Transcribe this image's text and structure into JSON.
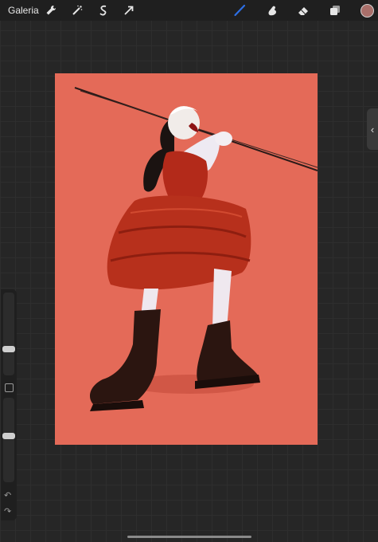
{
  "topbar": {
    "gallery_label": "Galeria",
    "left_tools": [
      {
        "name": "actions-wrench-icon"
      },
      {
        "name": "adjustments-wand-icon"
      },
      {
        "name": "selection-icon"
      },
      {
        "name": "transform-arrow-icon"
      }
    ],
    "right_tools": [
      {
        "name": "brush-icon",
        "active": true
      },
      {
        "name": "smudge-icon",
        "active": false
      },
      {
        "name": "eraser-icon",
        "active": false
      },
      {
        "name": "layers-icon",
        "active": false
      }
    ],
    "current_color": "#a96f6a",
    "active_tool_color": "#2d6fe6"
  },
  "canvas": {
    "background_color": "#e46a58"
  },
  "sidebar": {
    "brush_size_level": 0.3,
    "opacity_level": 0.55
  }
}
